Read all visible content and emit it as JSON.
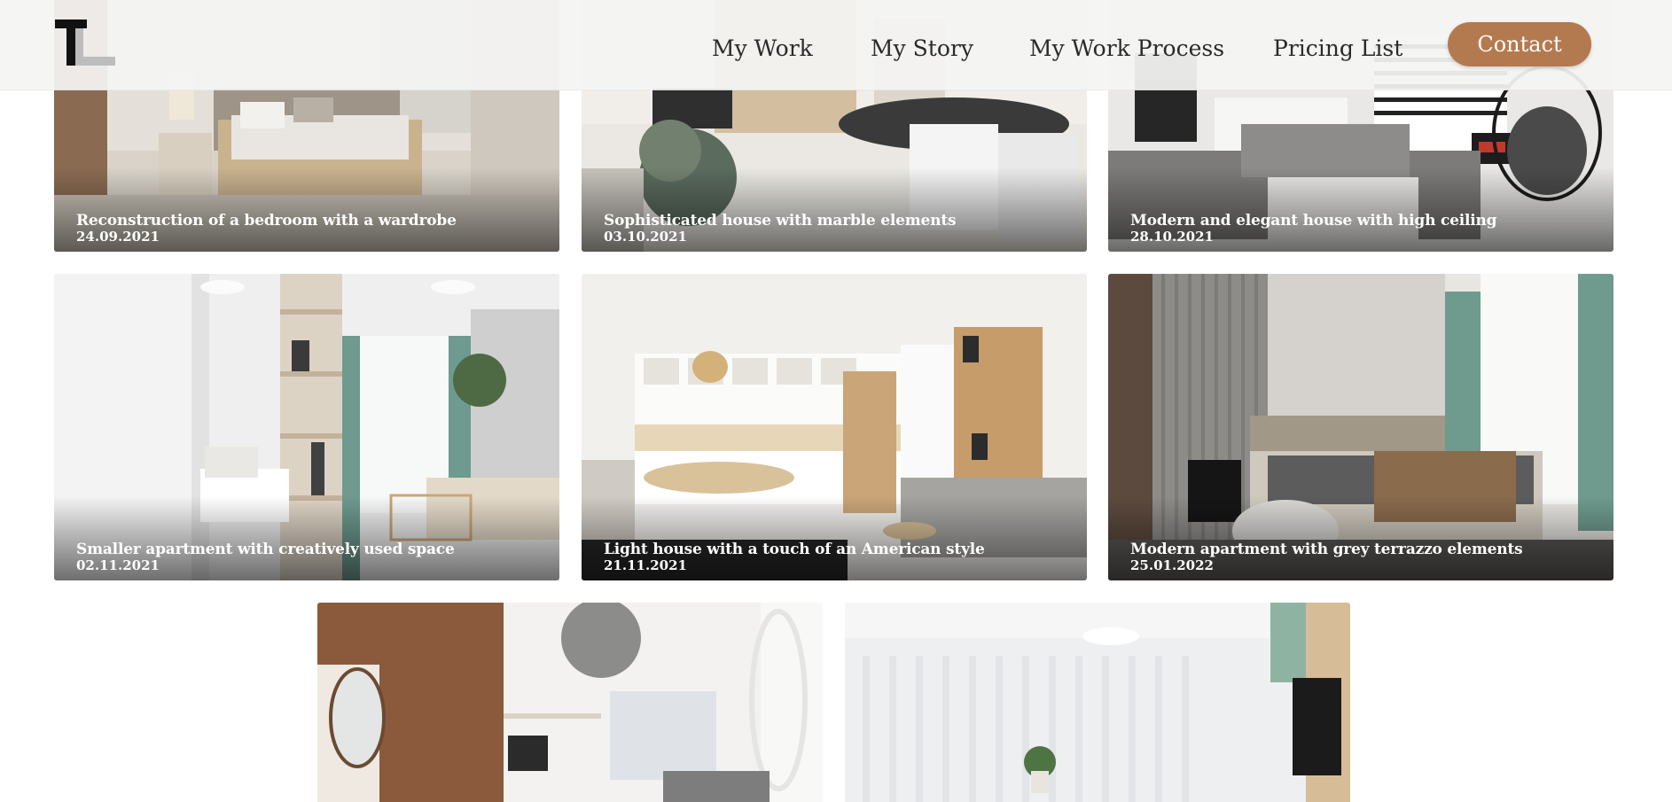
{
  "header": {
    "logo_letters": "TL",
    "nav": [
      {
        "label": "My Work"
      },
      {
        "label": "My Story"
      },
      {
        "label": "My Work Process"
      },
      {
        "label": "Pricing List"
      }
    ],
    "contact_label": "Contact",
    "accent_color": "#b47a4f"
  },
  "projects": [
    {
      "title": "Reconstruction of a bedroom with a wardrobe",
      "date": "24.09.2021"
    },
    {
      "title": "Sophisticated house with marble elements",
      "date": "03.10.2021"
    },
    {
      "title": "Modern and elegant house with high ceiling",
      "date": "28.10.2021"
    },
    {
      "title": "Smaller apartment with creatively used space",
      "date": "02.11.2021"
    },
    {
      "title": "Light house with a touch of an American style",
      "date": "21.11.2021"
    },
    {
      "title": "Modern apartment with grey terrazzo elements",
      "date": "25.01.2022"
    },
    {
      "title": "",
      "date": ""
    },
    {
      "title": "",
      "date": ""
    }
  ]
}
